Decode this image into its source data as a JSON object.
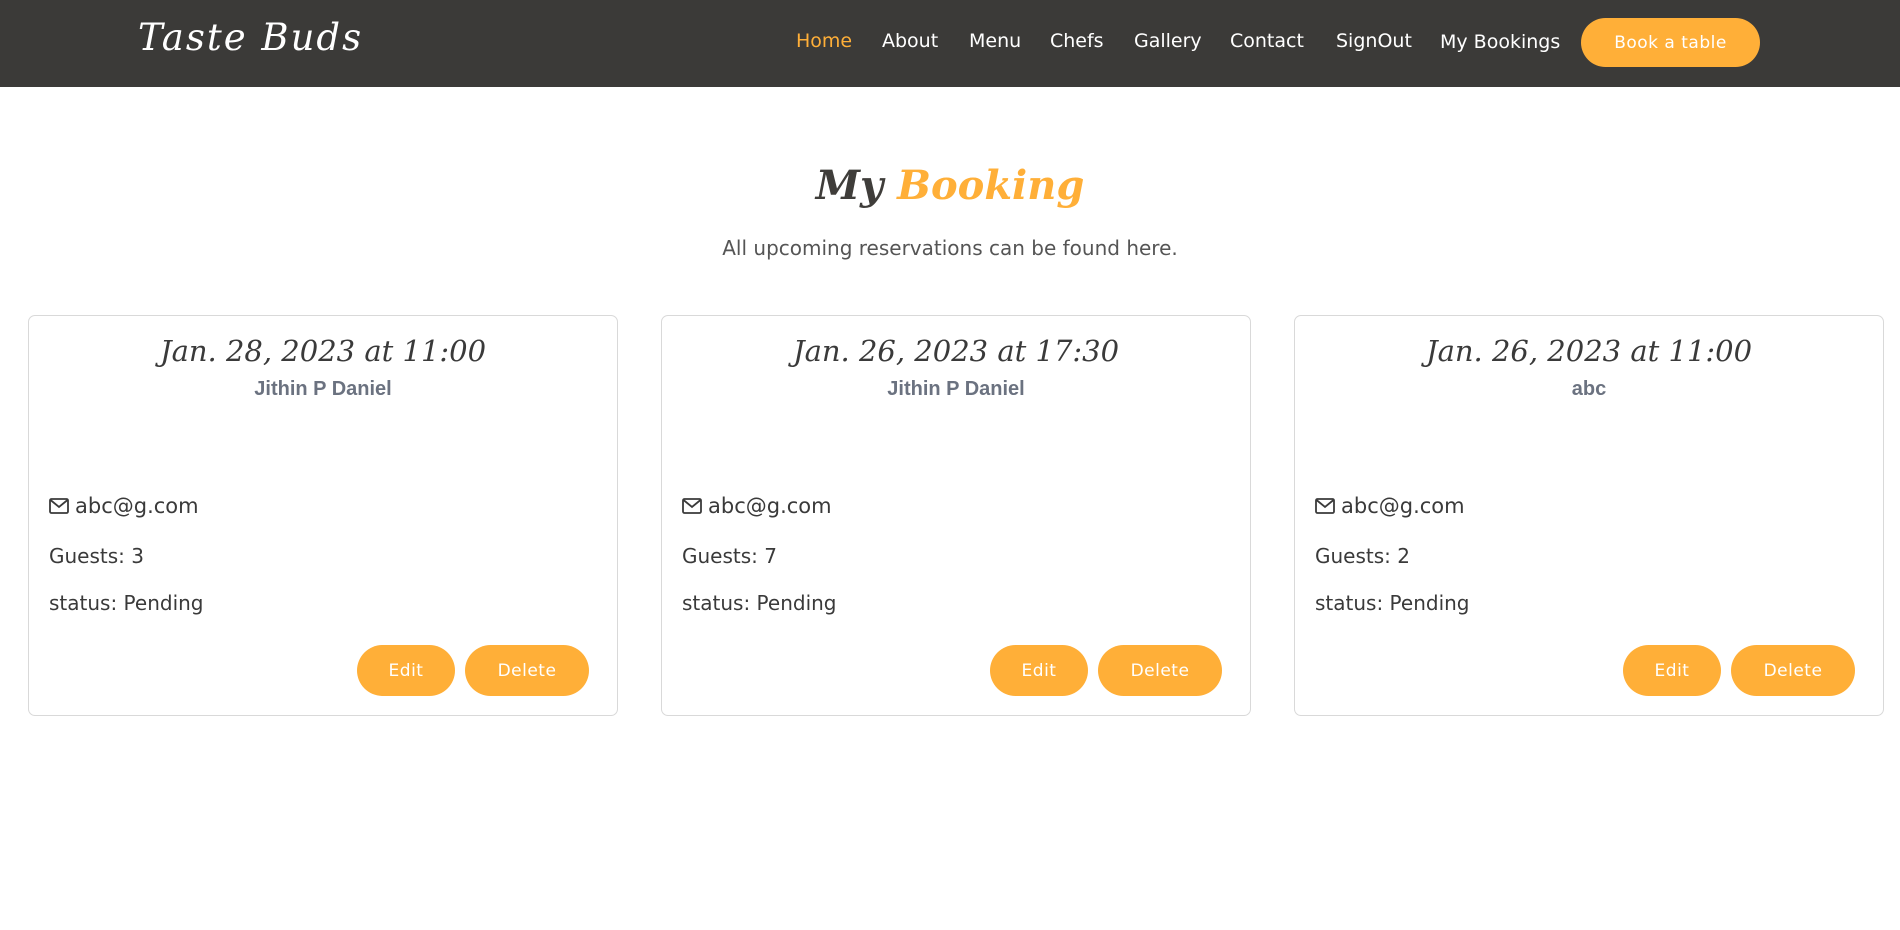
{
  "brand": {
    "name": "Taste Buds"
  },
  "nav": {
    "items": [
      {
        "label": "Home",
        "active": true
      },
      {
        "label": "About",
        "active": false
      },
      {
        "label": "Menu",
        "active": false
      },
      {
        "label": "Chefs",
        "active": false
      },
      {
        "label": "Gallery",
        "active": false
      },
      {
        "label": "Contact",
        "active": false
      },
      {
        "label": "SignOut",
        "active": false
      },
      {
        "label": "My Bookings",
        "active": false
      }
    ],
    "cta_label": "Book a table"
  },
  "page": {
    "title_part1": "My",
    "title_part2": "Booking",
    "subtitle": "All upcoming reservations can be found here."
  },
  "bookings": [
    {
      "date": "Jan. 28, 2023 at 11:00",
      "name": "Jithin P Daniel",
      "email": "abc@g.com",
      "guests": "Guests: 3",
      "status": "status: Pending"
    },
    {
      "date": "Jan. 26, 2023 at 17:30",
      "name": "Jithin P Daniel",
      "email": "abc@g.com",
      "guests": "Guests: 7",
      "status": "status: Pending"
    },
    {
      "date": "Jan. 26, 2023 at 11:00",
      "name": "abc",
      "email": "abc@g.com",
      "guests": "Guests: 2",
      "status": "status: Pending"
    }
  ],
  "actions": {
    "edit_label": "Edit",
    "delete_label": "Delete"
  },
  "icons": {
    "email": "envelope-icon"
  },
  "colors": {
    "accent": "#ffaf38",
    "header_bg": "#3b3a38",
    "heading_dark": "#3f3d3a",
    "name_gray": "#6b7280"
  }
}
